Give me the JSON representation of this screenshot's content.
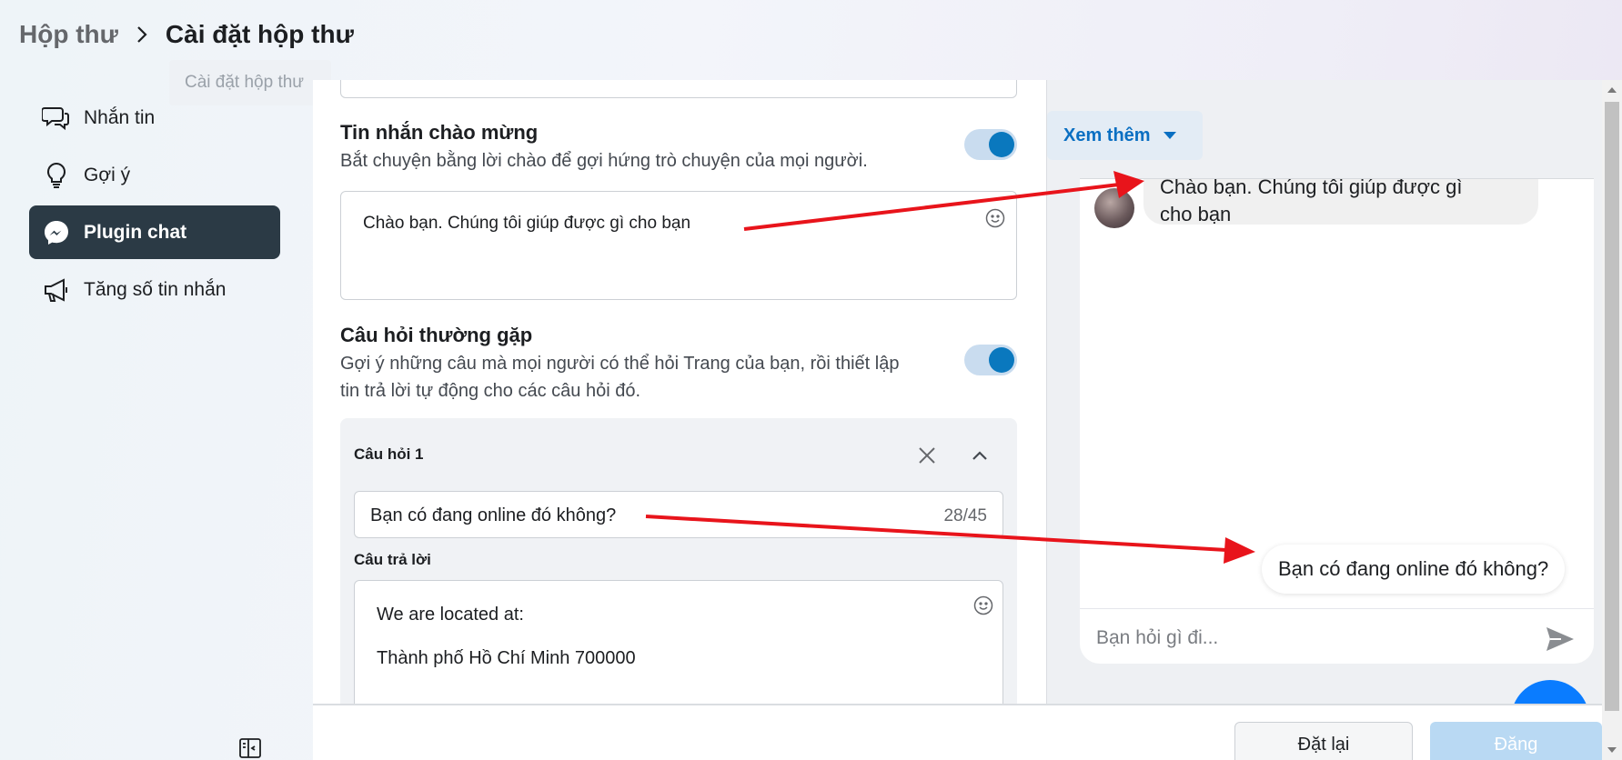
{
  "header": {
    "breadcrumb_root": "Hộp thư",
    "breadcrumb_current": "Cài đặt hộp thư",
    "tooltip": "Cài đặt hộp thư"
  },
  "sidebar": {
    "items": [
      {
        "label": "Nhắn tin",
        "icon": "chat-bubbles-icon"
      },
      {
        "label": "Gợi ý",
        "icon": "lightbulb-icon"
      },
      {
        "label": "Plugin chat",
        "icon": "messenger-icon",
        "active": true
      },
      {
        "label": "Tăng số tin nhắn",
        "icon": "megaphone-icon"
      }
    ]
  },
  "greeting": {
    "title": "Tin nhắn chào mừng",
    "description": "Bắt chuyện bằng lời chào để gợi hứng trò chuyện của mọi người.",
    "enabled": true,
    "message": "Chào bạn. Chúng tôi giúp được gì cho bạn"
  },
  "faq": {
    "title": "Câu hỏi thường gặp",
    "description_line1": "Gợi ý những câu mà mọi người có thể hỏi Trang của bạn, rồi thiết lập",
    "description_line2": "tin trả lời tự động cho các câu hỏi đó.",
    "enabled": true,
    "question_title": "Câu hỏi 1",
    "question_value": "Bạn có đang online đó không?",
    "question_count": "28/45",
    "answer_label": "Câu trả lời",
    "answer_line1": "We are located at:",
    "answer_line2": "Thành phố Hồ Chí Minh 700000"
  },
  "preview": {
    "see_more": "Xem thêm",
    "bot_message_line1": "Chào bạn. Chúng tôi giúp được gì",
    "bot_message_line2": "cho bạn",
    "user_message": "Bạn có đang online đó không?",
    "input_placeholder": "Bạn hỏi gì đi..."
  },
  "footer": {
    "reset_label": "Đặt lại",
    "publish_label": "Đăng"
  },
  "colors": {
    "accent": "#0a78be",
    "active_nav": "#2b3a45",
    "annotation_arrow": "#e8141b"
  }
}
